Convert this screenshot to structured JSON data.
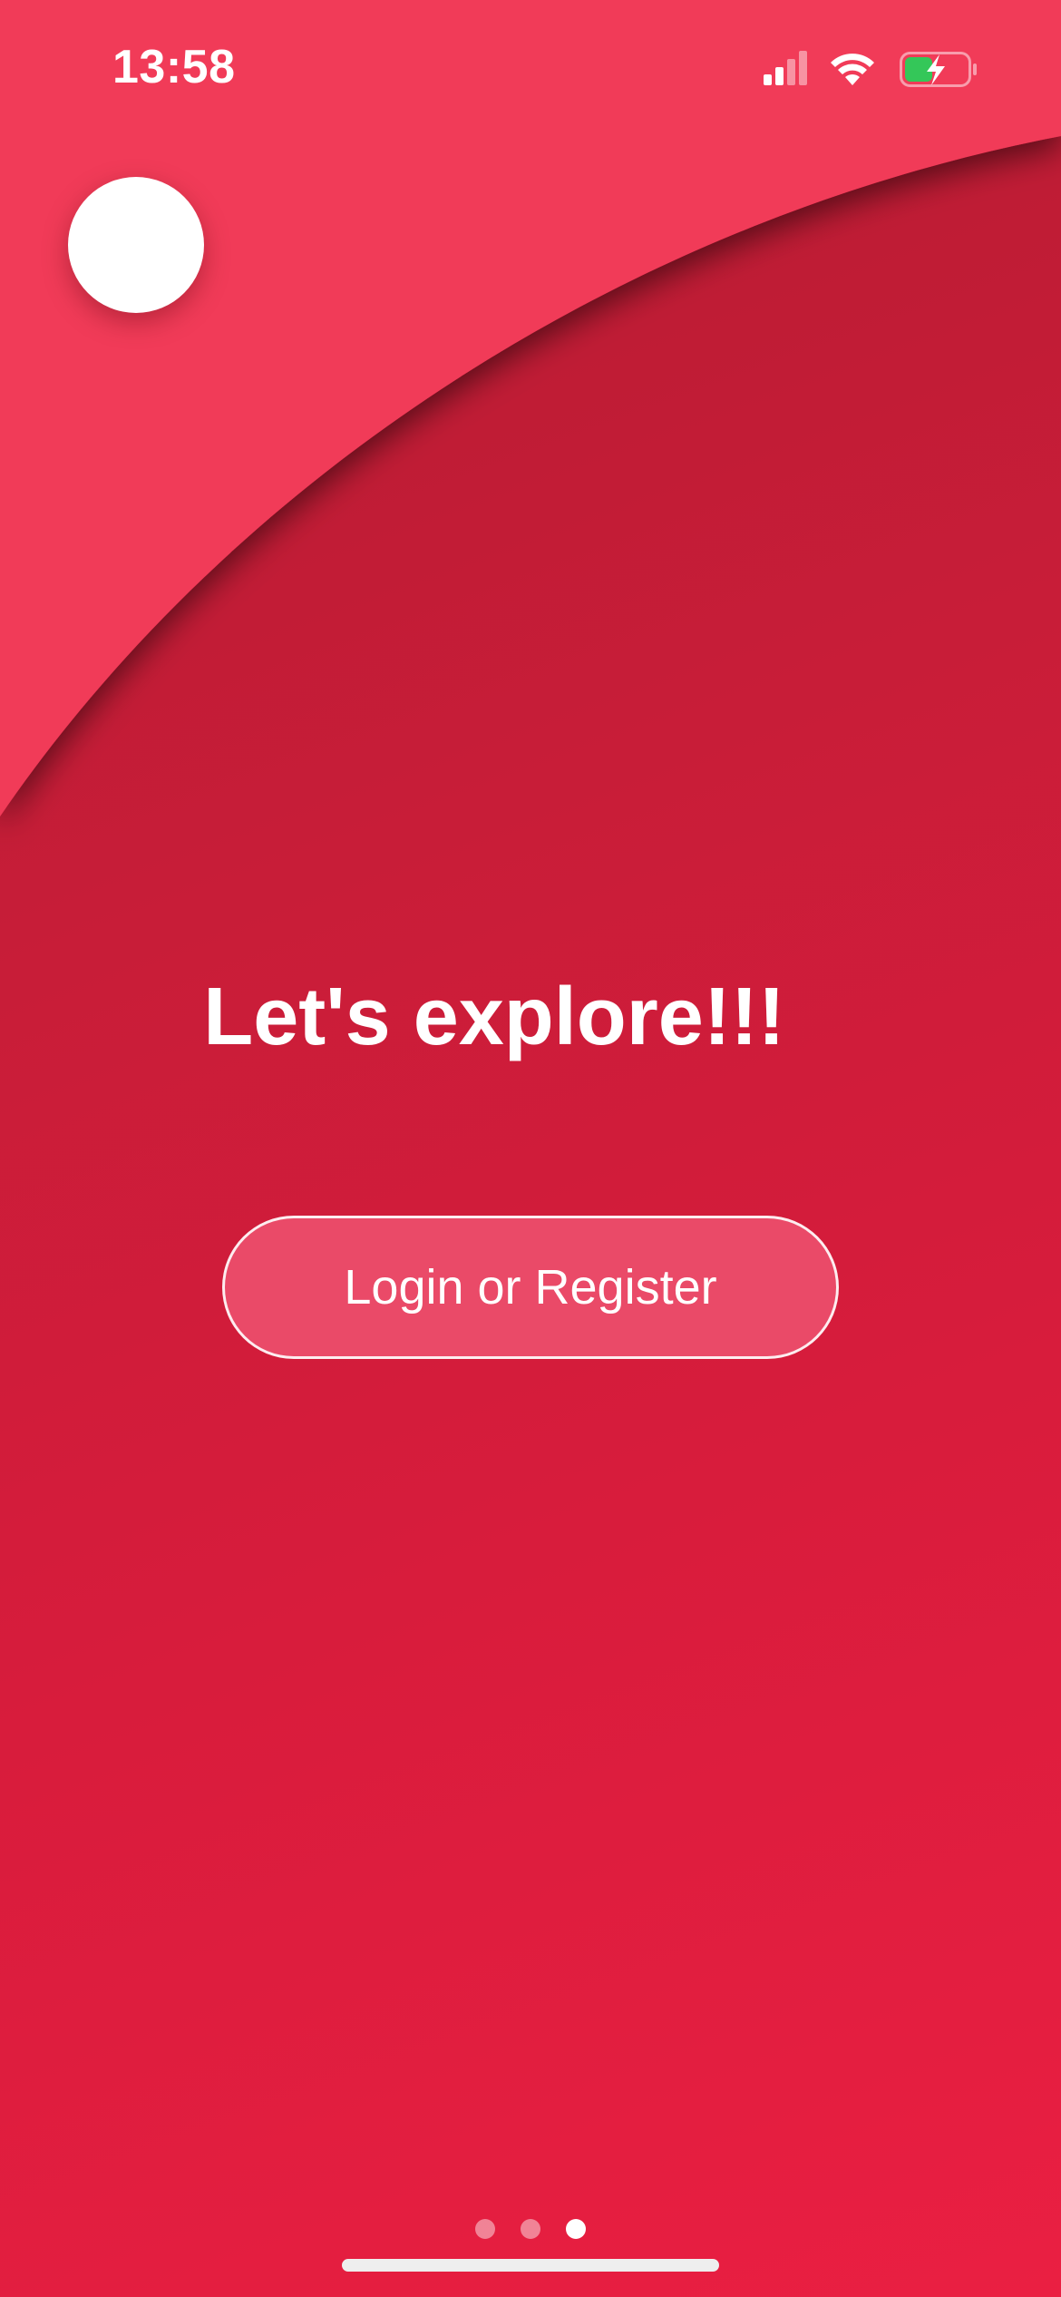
{
  "status_bar": {
    "time": "13:58",
    "signal_icon": "cellular-signal-icon",
    "wifi_icon": "wifi-icon",
    "battery_icon": "battery-charging-icon"
  },
  "colors": {
    "top_background": "#f13a59",
    "main_background": "#c71d38",
    "button_fill": "#ea4a68",
    "battery_fill": "#34c759"
  },
  "main": {
    "headline": "Let's explore!!!",
    "login_button_label": "Login or Register"
  },
  "pager": {
    "page_count": 3,
    "active_page": 3
  }
}
